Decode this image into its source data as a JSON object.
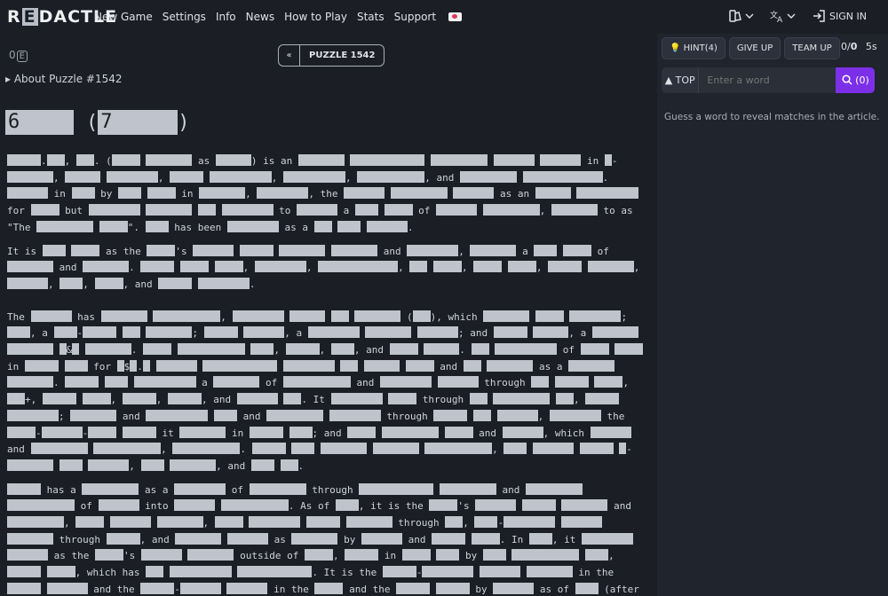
{
  "nav": {
    "logo_pre": "R",
    "logo_box": "E",
    "logo_post": "DACTLE",
    "links": [
      "New Game",
      "Settings",
      "Info",
      "News",
      "How to Play",
      "Stats",
      "Support"
    ],
    "sign_in": "SIGN IN"
  },
  "puzzle": {
    "eye_count": "0",
    "eye_box": "E",
    "prev": "«",
    "label": "PUZZLE 1542",
    "about": "About Puzzle #1542"
  },
  "title": {
    "a": "6",
    "b": "7",
    "open_paren": "(",
    "close_paren": ")"
  },
  "panel": {
    "hint": "HINT(4)",
    "give_up": "GIVE UP",
    "team_up": "TEAM UP",
    "score_a": "0/",
    "score_b": "0",
    "time": "5s",
    "top": "TOP",
    "placeholder": "Enter a word",
    "go_count": "(0)",
    "help": "Guess a word to reveal matches in the article."
  },
  "colors": {
    "accent": "#7b30e8",
    "redaction": "#bfc4cc",
    "bg": "#1b1e25"
  }
}
